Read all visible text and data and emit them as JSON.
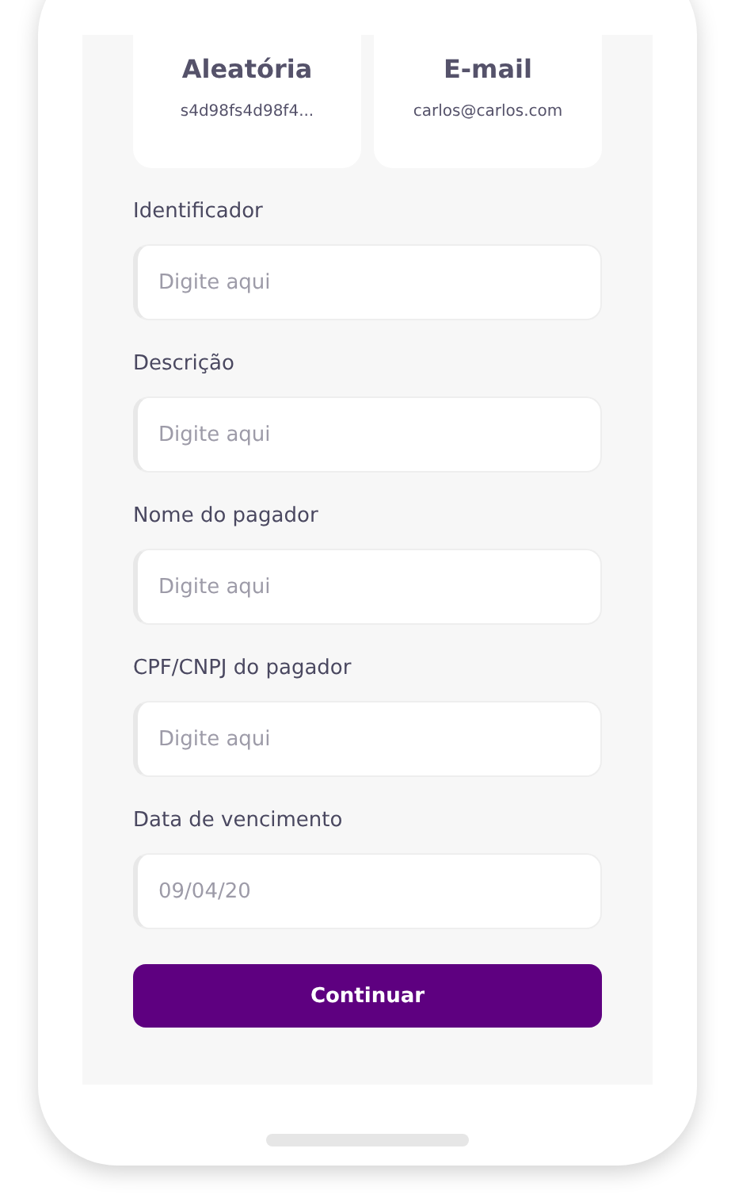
{
  "key_cards": [
    {
      "title": "Aleatória",
      "value": "s4d98fs4d98f4..."
    },
    {
      "title": "E-mail",
      "value": "carlos@carlos.com"
    }
  ],
  "fields": [
    {
      "label": "Identificador",
      "placeholder": "Digite aqui"
    },
    {
      "label": "Descrição",
      "placeholder": "Digite aqui"
    },
    {
      "label": "Nome do pagador",
      "placeholder": "Digite aqui"
    },
    {
      "label": "CPF/CNPJ do pagador",
      "placeholder": "Digite aqui"
    },
    {
      "label": "Data de vencimento",
      "placeholder": "09/04/20"
    }
  ],
  "button": "Continuar"
}
